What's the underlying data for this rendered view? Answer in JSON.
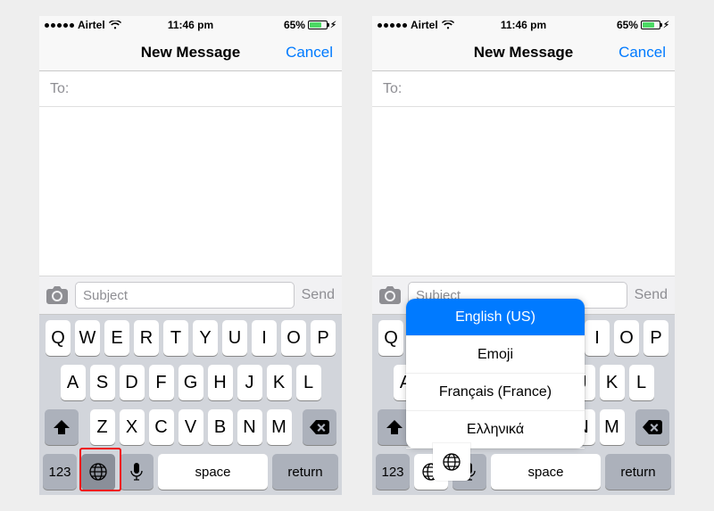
{
  "statusbar": {
    "carrier": "Airtel",
    "time": "11:46 pm",
    "battery_pct": "65%"
  },
  "navbar": {
    "title": "New Message",
    "cancel": "Cancel"
  },
  "compose": {
    "to_label": "To:",
    "subject_placeholder": "Subject",
    "send_label": "Send"
  },
  "keyboard": {
    "row1": [
      "Q",
      "W",
      "E",
      "R",
      "T",
      "Y",
      "U",
      "I",
      "O",
      "P"
    ],
    "row2": [
      "A",
      "S",
      "D",
      "F",
      "G",
      "H",
      "J",
      "K",
      "L"
    ],
    "row3": [
      "Z",
      "X",
      "C",
      "V",
      "B",
      "N",
      "M"
    ],
    "num_key": "123",
    "space": "space",
    "return": "return"
  },
  "language_menu": {
    "items": [
      {
        "label": "English (US)",
        "selected": true
      },
      {
        "label": "Emoji",
        "selected": false
      },
      {
        "label": "Français (France)",
        "selected": false
      },
      {
        "label": "Ελληνικά",
        "selected": false
      }
    ]
  }
}
